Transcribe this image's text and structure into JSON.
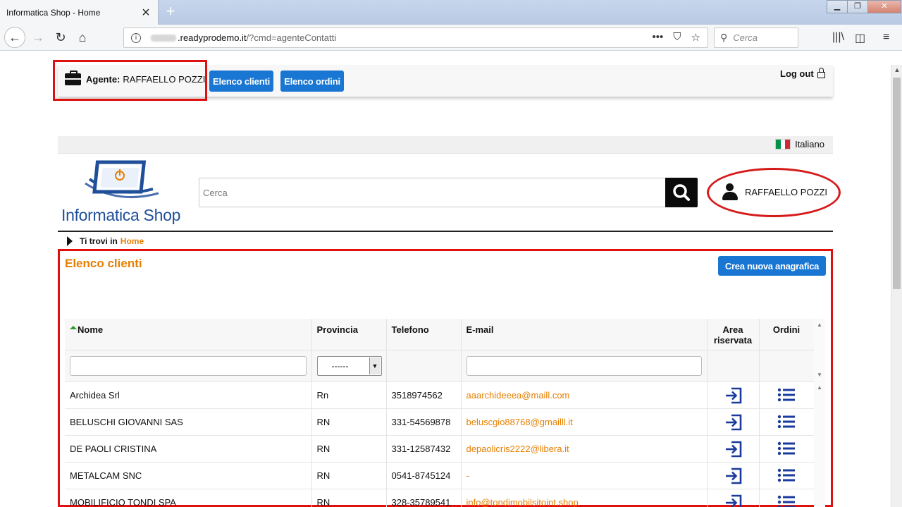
{
  "browser": {
    "tab_title": "Informatica Shop - Home",
    "url_host": ".readyprodemo.it",
    "url_path": "/?cmd=agenteContatti",
    "search_placeholder": "Cerca"
  },
  "agent_bar": {
    "agent_label": "Agente:",
    "agent_name": "RAFFAELLO POZZI",
    "btn_clients": "Elenco clienti",
    "btn_orders": "Elenco ordini",
    "logout": "Log out"
  },
  "header": {
    "language": "Italiano",
    "logo_text": "Informatica Shop",
    "search_placeholder": "Cerca",
    "user_name": "RAFFAELLO POZZI"
  },
  "breadcrumb": {
    "prefix": "Ti trovi in",
    "current": "Home"
  },
  "clients": {
    "title": "Elenco clienti",
    "new_button": "Crea nuova anagrafica",
    "columns": {
      "name": "Nome",
      "province": "Provincia",
      "phone": "Telefono",
      "email": "E-mail",
      "area": "Area riservata",
      "orders": "Ordini"
    },
    "province_filter_value": "------",
    "rows": [
      {
        "name": "Archidea Srl",
        "province": "Rn",
        "phone": "3518974562",
        "email": "aaarchideeea@maill.com"
      },
      {
        "name": "BELUSCHI GIOVANNI SAS",
        "province": "RN",
        "phone": "331-54569878",
        "email": "beluscgio88768@gmailll.it"
      },
      {
        "name": "DE PAOLI CRISTINA",
        "province": "RN",
        "phone": "331-12587432",
        "email": "depaolicris2222@libera.it"
      },
      {
        "name": "METALCAM SNC",
        "province": "RN",
        "phone": "0541-8745124",
        "email": "-"
      },
      {
        "name": "MOBILIFICIO TONDI SPA",
        "province": "RN",
        "phone": "328-35789541",
        "email": "info@tondimobilsitoint.shop"
      }
    ]
  },
  "colors": {
    "accent_blue": "#1976d2",
    "accent_orange": "#e67e00",
    "highlight_red": "#e01010"
  }
}
